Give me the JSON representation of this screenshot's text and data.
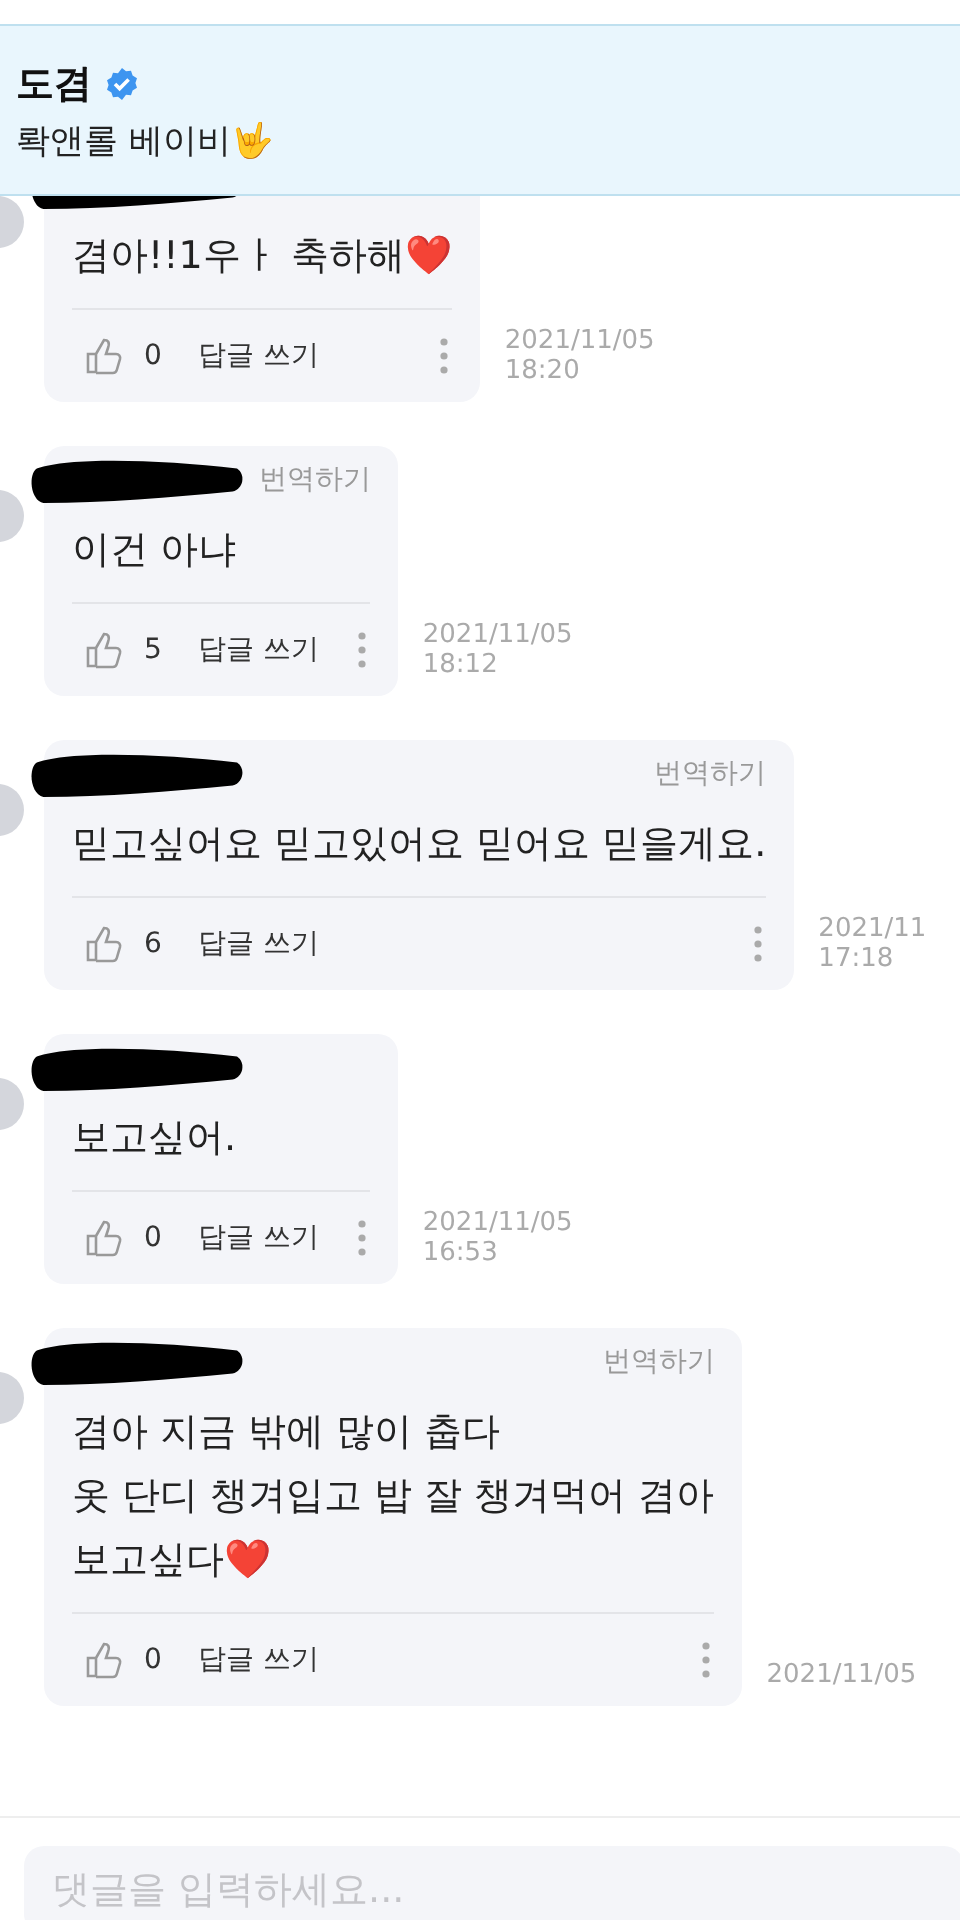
{
  "header": {
    "name": "도겸",
    "verified": true,
    "status": "롹앤롤 베이비🤟"
  },
  "comments": [
    {
      "name_redacted": true,
      "text": "겸아!!1우ㅏ 축하해❤️",
      "likes": "0",
      "reply": "답글 쓰기",
      "date": "2021/11/05",
      "time": "18:20"
    },
    {
      "name_redacted": true,
      "translate": "번역하기",
      "text": "이건 아냐",
      "likes": "5",
      "reply": "답글 쓰기",
      "date": "2021/11/05",
      "time": "18:12"
    },
    {
      "name_redacted": true,
      "translate": "번역하기",
      "text": "믿고싶어요 믿고있어요 믿어요 믿을게요.",
      "likes": "6",
      "reply": "답글 쓰기",
      "date": "2021/11",
      "time": "17:18"
    },
    {
      "name_redacted": true,
      "text": "보고싶어.",
      "likes": "0",
      "reply": "답글 쓰기",
      "date": "2021/11/05",
      "time": "16:53"
    },
    {
      "name_redacted": true,
      "translate": "번역하기",
      "text": "겸아 지금 밖에 많이 춥다\n옷 단디 챙겨입고 밥 잘 챙겨먹어 겸아\n보고싶다❤️",
      "likes": "0",
      "reply": "답글 쓰기",
      "date": "2021/11/05"
    }
  ],
  "comment_input": {
    "placeholder": "댓글을 입력하세요..."
  }
}
